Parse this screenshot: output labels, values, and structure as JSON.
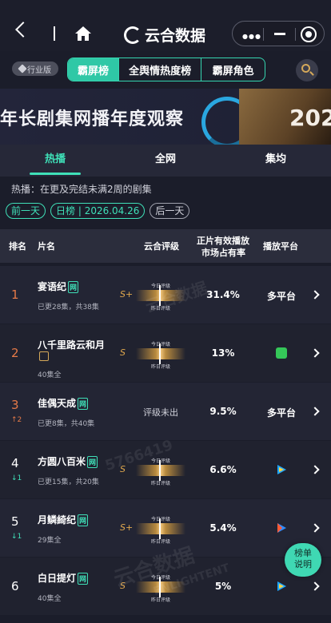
{
  "topbar": {
    "brand": "云合数据"
  },
  "ranktabs": {
    "industry": "行业版",
    "tabs": [
      "霸屏榜",
      "全舆情热度榜",
      "霸屏角色"
    ]
  },
  "banner": {
    "title": "年长剧集网播年度观察",
    "year": "202"
  },
  "subtabs": [
    "热播",
    "全网",
    "集均"
  ],
  "note": "热播：在更及完结未满2周的剧集",
  "dates": {
    "prev": "前一天",
    "current": "日榜 | 2026.04.26",
    "next": "后一天"
  },
  "table": {
    "headers": {
      "rank": "排名",
      "name": "片名",
      "rating": "云合评级",
      "share_line1": "正片有效播放",
      "share_line2": "市场占有率",
      "platform": "播放平台"
    },
    "rating_top": "今日评级",
    "rating_bottom": "昨日评级",
    "rows": [
      {
        "rank": "1",
        "name": "宴语纪",
        "tag": "网",
        "sub": "已更28集，共38集",
        "grade": "S+",
        "rating_mark": "S+",
        "share": "31.4%",
        "platform": "多平台"
      },
      {
        "rank": "2",
        "name": "八千里路云和月",
        "sub": "40集全",
        "grade": "S",
        "rating_mark": "S",
        "share": "13%",
        "platform_icon": "iqiyi-icon",
        "platform_color": "#35c759"
      },
      {
        "rank": "3",
        "change": "↑2",
        "name": "佳偶天成",
        "tag": "网",
        "sub": "已更8集，共40集",
        "unrated": "评级未出",
        "share": "9.5%",
        "platform": "多平台"
      },
      {
        "rank": "4",
        "change": "↓1",
        "name": "方圆八百米",
        "tag": "网",
        "sub": "已更15集，共20集",
        "grade": "S",
        "rating_mark": "S",
        "share": "6.6%",
        "platform_icon": "tencent-video-icon",
        "platform_color": "#1ea7ff"
      },
      {
        "rank": "5",
        "change": "↓1",
        "name": "月鳞綺纪",
        "tag": "网",
        "sub": "29集全",
        "grade": "S+",
        "rating_mark": "S+",
        "share": "5.4%",
        "platform_icon": "youku-icon",
        "platform_color": "#2f8cff"
      },
      {
        "rank": "6",
        "name": "白日提灯",
        "tag": "网",
        "sub": "40集全",
        "grade": "S",
        "rating_mark": "S",
        "share": "5%",
        "platform_icon": "tencent-video-icon",
        "platform_color": "#1ea7ff"
      }
    ]
  },
  "float_button": {
    "line1": "榜单",
    "line2": "说明"
  },
  "watermarks": [
    "云合数据",
    "5766419",
    "云合数据",
    "ENLIGHTENT"
  ],
  "colors": {
    "accent": "#3fe0b8",
    "gold": "#e0a84e",
    "top_rank": "#e57a48",
    "bg": "#1b1d2a"
  }
}
